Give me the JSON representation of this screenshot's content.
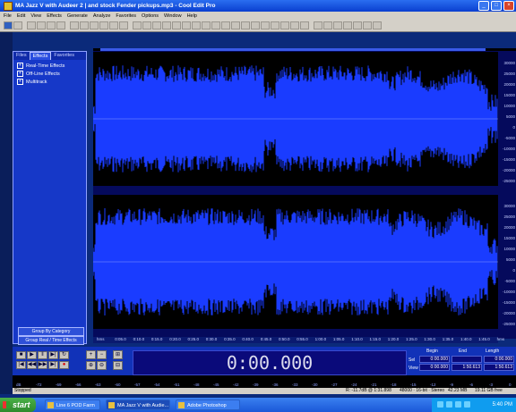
{
  "window": {
    "title": "MA Jazz V with Audeer 2 | and stock Fender pickups.mp3 - Cool Edit Pro"
  },
  "menu": [
    "File",
    "Edit",
    "View",
    "Effects",
    "Generate",
    "Analyze",
    "Favorites",
    "Options",
    "Window",
    "Help"
  ],
  "organizer": {
    "tabs": [
      "Files",
      "Effects",
      "Favorites"
    ],
    "tree": [
      "Real-Time Effects",
      "Off-Line Effects",
      "Multitrack"
    ],
    "buttons": [
      "Group By Category",
      "Group Real / Time Effects"
    ]
  },
  "ruler": [
    "hms",
    "0:05.0",
    "0:10.0",
    "0:15.0",
    "0:20.0",
    "0:25.0",
    "0:30.0",
    "0:35.0",
    "0:40.0",
    "0:45.0",
    "0:50.0",
    "0:55.0",
    "1:00.0",
    "1:05.0",
    "1:10.0",
    "1:15.0",
    "1:20.0",
    "1:25.0",
    "1:30.0",
    "1:35.0",
    "1:40.0",
    "1:45.0",
    "hms"
  ],
  "amplitude_labels": [
    "30000",
    "25000",
    "20000",
    "15000",
    "10000",
    "5000",
    "0",
    "-5000",
    "-10000",
    "-15000",
    "-20000",
    "-25000"
  ],
  "time_display": "0:00.000",
  "selection": {
    "headers": [
      "Begin",
      "End",
      "Length"
    ],
    "sel_label": "Sel",
    "view_label": "View",
    "sel": [
      "0:00.000",
      "",
      "0:00.000"
    ],
    "view": [
      "0:00.000",
      "1:50.613",
      "1:50.613"
    ]
  },
  "level_scale": [
    "dB",
    "-72",
    "-69",
    "-66",
    "-63",
    "-60",
    "-57",
    "-54",
    "-51",
    "-48",
    "-45",
    "-42",
    "-39",
    "-36",
    "-33",
    "-30",
    "-27",
    "-24",
    "-21",
    "-18",
    "-15",
    "-12",
    "-9",
    "-6",
    "-3",
    "0"
  ],
  "status": {
    "left": "Stopped",
    "items": [
      "R: -11.7dB @ 1:31.898",
      "48000 · 16-bit · Stereo",
      "42.23 MB",
      "19.11 GB free"
    ]
  },
  "taskbar": {
    "start": "start",
    "items": [
      "Line 6 POD Farm",
      "MA Jazz V with Audie...",
      "Adobe Photoshop"
    ],
    "clock": "5:40 PM"
  },
  "colors": {
    "waveform": "#1a3cff",
    "background": "#050a5c",
    "panel": "#1638c8"
  }
}
